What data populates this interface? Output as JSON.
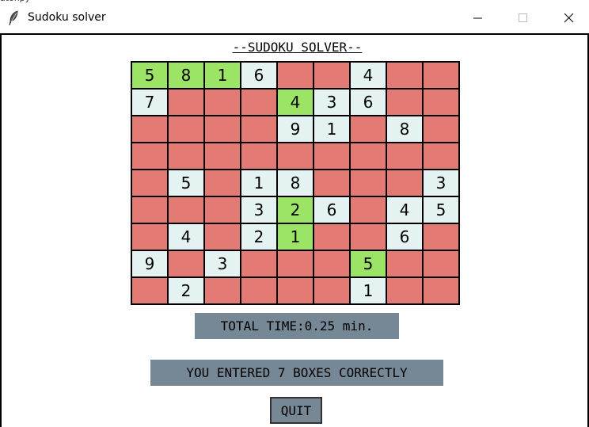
{
  "window": {
    "title": "Sudoku solver",
    "background_tab_text": "atonpy"
  },
  "heading": "--SUDOKU SOLVER--",
  "colors": {
    "wrong": "#e37a73",
    "correct": "#9be465",
    "given": "#e4f3f1",
    "panel": "#768796"
  },
  "board": [
    [
      {
        "v": "5",
        "s": "correct"
      },
      {
        "v": "8",
        "s": "correct"
      },
      {
        "v": "1",
        "s": "correct"
      },
      {
        "v": "6",
        "s": "given"
      },
      {
        "v": "",
        "s": "wrong"
      },
      {
        "v": "",
        "s": "wrong"
      },
      {
        "v": "4",
        "s": "given"
      },
      {
        "v": "",
        "s": "wrong"
      },
      {
        "v": "",
        "s": "wrong"
      }
    ],
    [
      {
        "v": "7",
        "s": "given"
      },
      {
        "v": "",
        "s": "wrong"
      },
      {
        "v": "",
        "s": "wrong"
      },
      {
        "v": "",
        "s": "wrong"
      },
      {
        "v": "4",
        "s": "correct"
      },
      {
        "v": "3",
        "s": "given"
      },
      {
        "v": "6",
        "s": "given"
      },
      {
        "v": "",
        "s": "wrong"
      },
      {
        "v": "",
        "s": "wrong"
      }
    ],
    [
      {
        "v": "",
        "s": "wrong"
      },
      {
        "v": "",
        "s": "wrong"
      },
      {
        "v": "",
        "s": "wrong"
      },
      {
        "v": "",
        "s": "wrong"
      },
      {
        "v": "9",
        "s": "given"
      },
      {
        "v": "1",
        "s": "given"
      },
      {
        "v": "",
        "s": "wrong"
      },
      {
        "v": "8",
        "s": "given"
      },
      {
        "v": "",
        "s": "wrong"
      }
    ],
    [
      {
        "v": "",
        "s": "wrong"
      },
      {
        "v": "",
        "s": "wrong"
      },
      {
        "v": "",
        "s": "wrong"
      },
      {
        "v": "",
        "s": "wrong"
      },
      {
        "v": "",
        "s": "wrong"
      },
      {
        "v": "",
        "s": "wrong"
      },
      {
        "v": "",
        "s": "wrong"
      },
      {
        "v": "",
        "s": "wrong"
      },
      {
        "v": "",
        "s": "wrong"
      }
    ],
    [
      {
        "v": "",
        "s": "wrong"
      },
      {
        "v": "5",
        "s": "given"
      },
      {
        "v": "",
        "s": "wrong"
      },
      {
        "v": "1",
        "s": "given"
      },
      {
        "v": "8",
        "s": "given"
      },
      {
        "v": "",
        "s": "wrong"
      },
      {
        "v": "",
        "s": "wrong"
      },
      {
        "v": "",
        "s": "wrong"
      },
      {
        "v": "3",
        "s": "given"
      }
    ],
    [
      {
        "v": "",
        "s": "wrong"
      },
      {
        "v": "",
        "s": "wrong"
      },
      {
        "v": "",
        "s": "wrong"
      },
      {
        "v": "3",
        "s": "given"
      },
      {
        "v": "2",
        "s": "correct"
      },
      {
        "v": "6",
        "s": "given"
      },
      {
        "v": "",
        "s": "wrong"
      },
      {
        "v": "4",
        "s": "given"
      },
      {
        "v": "5",
        "s": "given"
      }
    ],
    [
      {
        "v": "",
        "s": "wrong"
      },
      {
        "v": "4",
        "s": "given"
      },
      {
        "v": "",
        "s": "wrong"
      },
      {
        "v": "2",
        "s": "given"
      },
      {
        "v": "1",
        "s": "correct"
      },
      {
        "v": "",
        "s": "wrong"
      },
      {
        "v": "",
        "s": "wrong"
      },
      {
        "v": "6",
        "s": "given"
      },
      {
        "v": "",
        "s": "wrong"
      }
    ],
    [
      {
        "v": "9",
        "s": "given"
      },
      {
        "v": "",
        "s": "wrong"
      },
      {
        "v": "3",
        "s": "given"
      },
      {
        "v": "",
        "s": "wrong"
      },
      {
        "v": "",
        "s": "wrong"
      },
      {
        "v": "",
        "s": "wrong"
      },
      {
        "v": "5",
        "s": "correct"
      },
      {
        "v": "",
        "s": "wrong"
      },
      {
        "v": "",
        "s": "wrong"
      }
    ],
    [
      {
        "v": "",
        "s": "wrong"
      },
      {
        "v": "2",
        "s": "given"
      },
      {
        "v": "",
        "s": "wrong"
      },
      {
        "v": "",
        "s": "wrong"
      },
      {
        "v": "",
        "s": "wrong"
      },
      {
        "v": "",
        "s": "wrong"
      },
      {
        "v": "1",
        "s": "given"
      },
      {
        "v": "",
        "s": "wrong"
      },
      {
        "v": "",
        "s": "wrong"
      }
    ]
  ],
  "time_label": "TOTAL TIME:0.25 min.",
  "result_label": "YOU ENTERED 7 BOXES CORRECTLY",
  "quit_label": "QUIT",
  "icons": {
    "app": "feather-icon",
    "minimize": "minimize-icon",
    "maximize": "maximize-icon",
    "close": "close-icon"
  }
}
